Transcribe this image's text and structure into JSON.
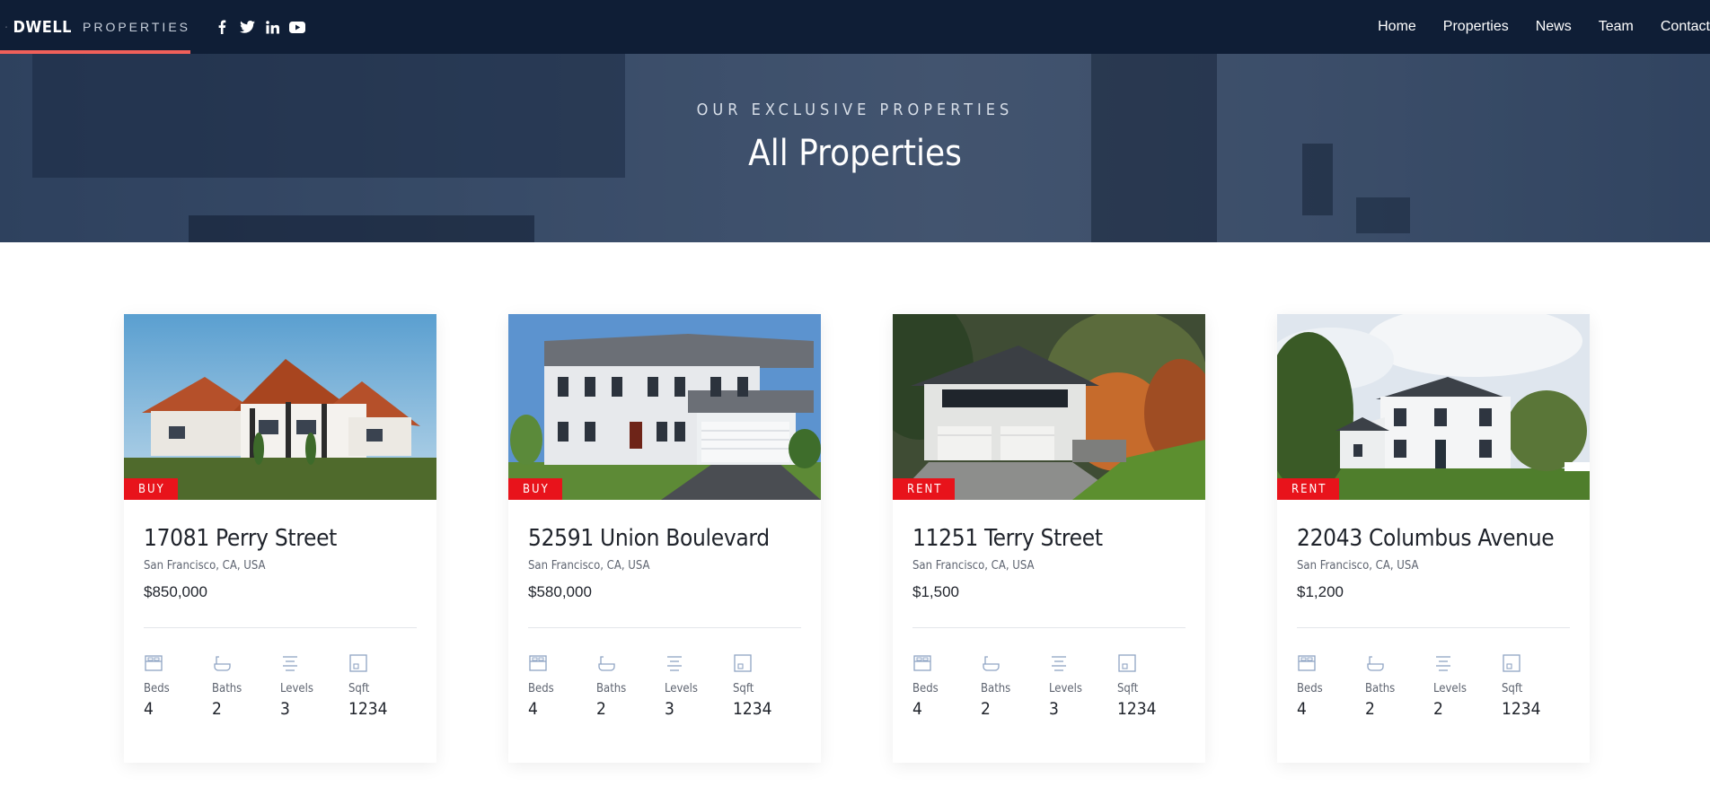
{
  "brand": {
    "name": "DWELL",
    "sub": "PROPERTIES",
    "accent_color": "#f0605a",
    "logo_icon": "house-outline-icon"
  },
  "social": [
    {
      "icon": "facebook-icon"
    },
    {
      "icon": "twitter-icon"
    },
    {
      "icon": "linkedin-icon"
    },
    {
      "icon": "youtube-icon"
    }
  ],
  "nav": {
    "items": [
      "Home",
      "Properties",
      "News",
      "Team",
      "Contact"
    ]
  },
  "hero": {
    "kicker": "OUR EXCLUSIVE PROPERTIES",
    "title": "All Properties"
  },
  "spec_labels": {
    "beds": "Beds",
    "baths": "Baths",
    "levels": "Levels",
    "sqft": "Sqft"
  },
  "properties": [
    {
      "tag": "BUY",
      "title": "17081 Perry Street",
      "location": "San Francisco, CA, USA",
      "price": "$850,000",
      "beds": "4",
      "baths": "2",
      "levels": "3",
      "sqft": "1234"
    },
    {
      "tag": "BUY",
      "title": "52591 Union Boulevard",
      "location": "San Francisco, CA, USA",
      "price": "$580,000",
      "beds": "4",
      "baths": "2",
      "levels": "3",
      "sqft": "1234"
    },
    {
      "tag": "RENT",
      "title": "11251 Terry Street",
      "location": "San Francisco, CA, USA",
      "price": "$1,500",
      "beds": "4",
      "baths": "2",
      "levels": "3",
      "sqft": "1234"
    },
    {
      "tag": "RENT",
      "title": "22043 Columbus Avenue",
      "location": "San Francisco, CA, USA",
      "price": "$1,200",
      "beds": "4",
      "baths": "2",
      "levels": "2",
      "sqft": "1234"
    }
  ],
  "colors": {
    "navbar": "#0f1e36",
    "tag": "#e8131b",
    "icon": "#8fa4c4"
  }
}
